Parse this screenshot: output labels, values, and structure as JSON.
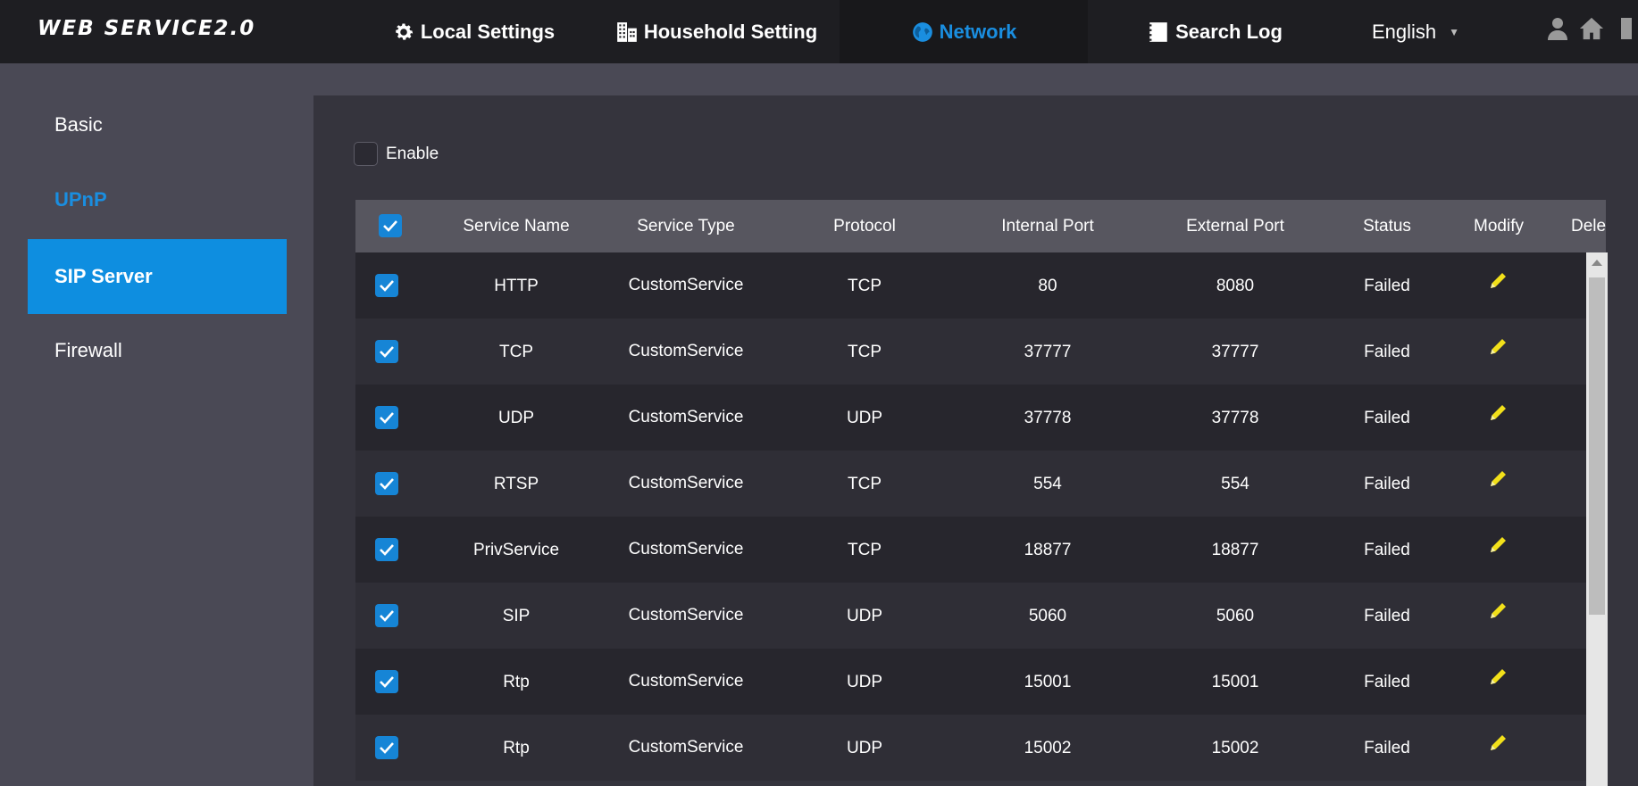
{
  "header": {
    "logo": "WEB SERVICE2.0",
    "nav": [
      {
        "label": "Local Settings",
        "icon": "gear-icon"
      },
      {
        "label": "Household Setting",
        "icon": "building-icon"
      },
      {
        "label": "Network",
        "icon": "globe-icon"
      },
      {
        "label": "Search Log",
        "icon": "log-icon"
      }
    ],
    "language": "English",
    "active_color": "#1a8ee0"
  },
  "sidebar": {
    "items": [
      {
        "label": "Basic"
      },
      {
        "label": "UPnP"
      },
      {
        "label": "SIP Server"
      },
      {
        "label": "Firewall"
      }
    ]
  },
  "main": {
    "enable_label": "Enable",
    "columns": [
      "Service Name",
      "Service Type",
      "Protocol",
      "Internal Port",
      "External Port",
      "Status",
      "Modify",
      "Dele"
    ],
    "rows": [
      {
        "name": "HTTP",
        "type": "CustomService",
        "protocol": "TCP",
        "internal": "80",
        "external": "8080",
        "status": "Failed"
      },
      {
        "name": "TCP",
        "type": "CustomService",
        "protocol": "TCP",
        "internal": "37777",
        "external": "37777",
        "status": "Failed"
      },
      {
        "name": "UDP",
        "type": "CustomService",
        "protocol": "UDP",
        "internal": "37778",
        "external": "37778",
        "status": "Failed"
      },
      {
        "name": "RTSP",
        "type": "CustomService",
        "protocol": "TCP",
        "internal": "554",
        "external": "554",
        "status": "Failed"
      },
      {
        "name": "PrivService",
        "type": "CustomService",
        "protocol": "TCP",
        "internal": "18877",
        "external": "18877",
        "status": "Failed"
      },
      {
        "name": "SIP",
        "type": "CustomService",
        "protocol": "UDP",
        "internal": "5060",
        "external": "5060",
        "status": "Failed"
      },
      {
        "name": "Rtp",
        "type": "CustomService",
        "protocol": "UDP",
        "internal": "15001",
        "external": "15001",
        "status": "Failed"
      },
      {
        "name": "Rtp",
        "type": "CustomService",
        "protocol": "UDP",
        "internal": "15002",
        "external": "15002",
        "status": "Failed"
      }
    ]
  }
}
